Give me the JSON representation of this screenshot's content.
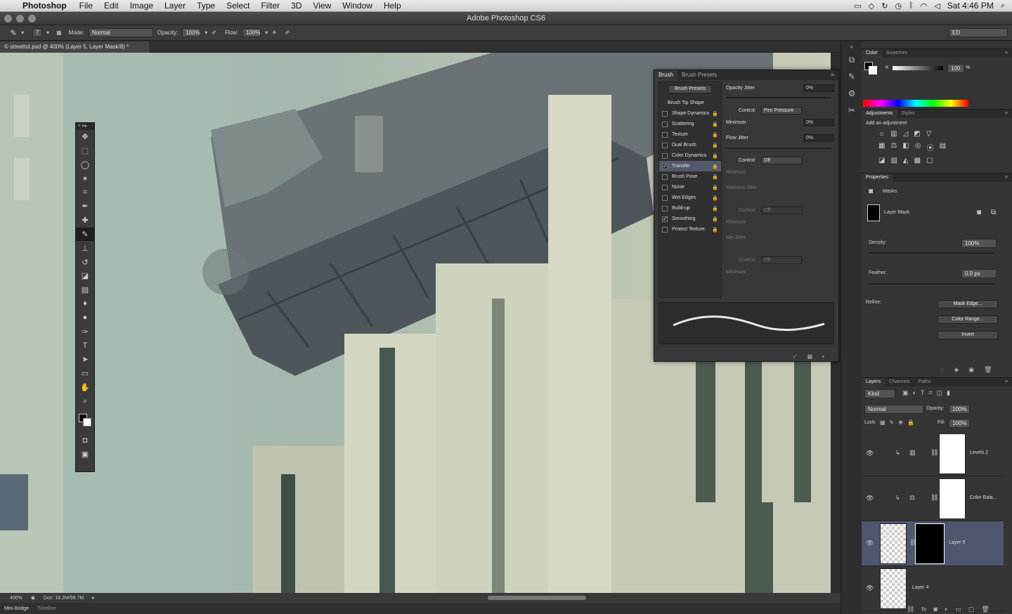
{
  "menubar": {
    "app": "Photoshop",
    "items": [
      "File",
      "Edit",
      "Image",
      "Layer",
      "Type",
      "Select",
      "Filter",
      "3D",
      "View",
      "Window",
      "Help"
    ],
    "clock": "Sat 4:46 PM"
  },
  "window": {
    "title": "Adobe Photoshop CS6"
  },
  "options": {
    "brush_size": "7",
    "mode_label": "Mode:",
    "mode_value": "Normal",
    "opacity_label": "Opacity:",
    "opacity_value": "100%",
    "flow_label": "Flow:",
    "flow_value": "100%",
    "workspace": "ED"
  },
  "document": {
    "tab_title": "© streettut.psd @ 400% (Layer 5, Layer Mask/8) *",
    "zoom": "400%",
    "doc_info": "Doc: 16.2M/99.7M"
  },
  "bottom_tabs": [
    "Mini Bridge",
    "Timeline"
  ],
  "brush_panel": {
    "tabs": [
      "Brush",
      "Brush Presets"
    ],
    "presets_button": "Brush Presets",
    "tip_shape": "Brush Tip Shape",
    "options": [
      {
        "label": "Shape Dynamics",
        "checked": false
      },
      {
        "label": "Scattering",
        "checked": false
      },
      {
        "label": "Texture",
        "checked": false
      },
      {
        "label": "Dual Brush",
        "checked": false
      },
      {
        "label": "Color Dynamics",
        "checked": false
      },
      {
        "label": "Transfer",
        "checked": true,
        "selected": true
      },
      {
        "label": "Brush Pose",
        "checked": false
      },
      {
        "label": "Noise",
        "checked": false
      },
      {
        "label": "Wet Edges",
        "checked": false
      },
      {
        "label": "Build-up",
        "checked": false
      },
      {
        "label": "Smoothing",
        "checked": true
      },
      {
        "label": "Protect Texture",
        "checked": false
      }
    ],
    "opacity_jitter_label": "Opacity Jitter",
    "opacity_jitter": "0%",
    "control_label": "Control:",
    "control1": "Pen Pressure",
    "minimum_label": "Minimum",
    "minimum1": "0%",
    "flow_jitter_label": "Flow Jitter",
    "flow_jitter": "0%",
    "control2": "Off",
    "wetness_label": "Wetness Jitter",
    "control3": "Off",
    "mix_label": "Mix Jitter",
    "control4": "Off"
  },
  "color_panel": {
    "tabs": [
      "Color",
      "Swatches"
    ],
    "channel": "K",
    "value": "100",
    "unit": "%"
  },
  "adjustments_panel": {
    "tabs": [
      "Adjustments",
      "Styles"
    ],
    "heading": "Add an adjustment"
  },
  "properties_panel": {
    "title": "Properties",
    "subtitle": "Masks",
    "mask_name": "Layer Mask",
    "density_label": "Density:",
    "density": "100%",
    "feather_label": "Feather:",
    "feather": "0.0 px",
    "refine_label": "Refine:",
    "btn_mask_edge": "Mask Edge...",
    "btn_color_range": "Color Range...",
    "btn_invert": "Invert"
  },
  "layers_panel": {
    "tabs": [
      "Layers",
      "Channels",
      "Paths"
    ],
    "kind": "Kind",
    "blend": "Normal",
    "opacity_label": "Opacity:",
    "opacity": "100%",
    "lock_label": "Lock:",
    "fill_label": "Fill:",
    "fill": "100%",
    "layers": [
      {
        "name": "Levels 2"
      },
      {
        "name": "Color Bala..."
      },
      {
        "name": "Layer 5"
      },
      {
        "name": "Layer 4"
      }
    ]
  },
  "colors": {
    "accent_selected": "#52596a",
    "layer_selected": "#4e5670"
  }
}
